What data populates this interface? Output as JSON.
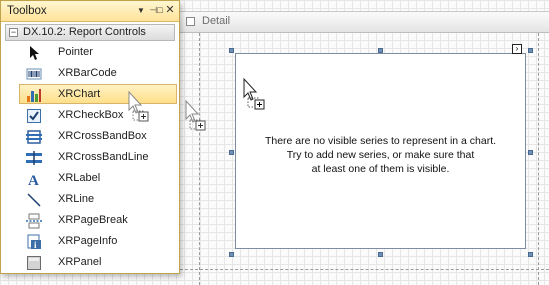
{
  "toolbox": {
    "title": "Toolbox",
    "buttons": {
      "dropdown": "▼",
      "pin": "⊣□",
      "close": "✕"
    },
    "group": {
      "label": "DX.10.2: Report Controls",
      "collapse_symbol": "−",
      "items": [
        {
          "label": "Pointer",
          "icon": "pointer-icon"
        },
        {
          "label": "XRBarCode",
          "icon": "barcode-icon"
        },
        {
          "label": "XRChart",
          "icon": "chart-icon",
          "selected": true
        },
        {
          "label": "XRCheckBox",
          "icon": "checkbox-icon"
        },
        {
          "label": "XRCrossBandBox",
          "icon": "crossband-box-icon"
        },
        {
          "label": "XRCrossBandLine",
          "icon": "crossband-line-icon"
        },
        {
          "label": "XRLabel",
          "icon": "label-icon"
        },
        {
          "label": "XRLine",
          "icon": "line-icon"
        },
        {
          "label": "XRPageBreak",
          "icon": "pagebreak-icon"
        },
        {
          "label": "XRPageInfo",
          "icon": "pageinfo-icon"
        },
        {
          "label": "XRPanel",
          "icon": "panel-icon"
        }
      ]
    }
  },
  "designer": {
    "band_title": "Detail",
    "chart_message": {
      "line1": "There are no visible series to represent in a chart.",
      "line2": "Try to add new series, or make sure that",
      "line3": "at least one of them is visible."
    },
    "smart_tag_symbol": "›"
  },
  "colors": {
    "toolbox_border": "#bfa24a",
    "selected_item": "#ffe08a",
    "handle": "#6e8fb6"
  }
}
